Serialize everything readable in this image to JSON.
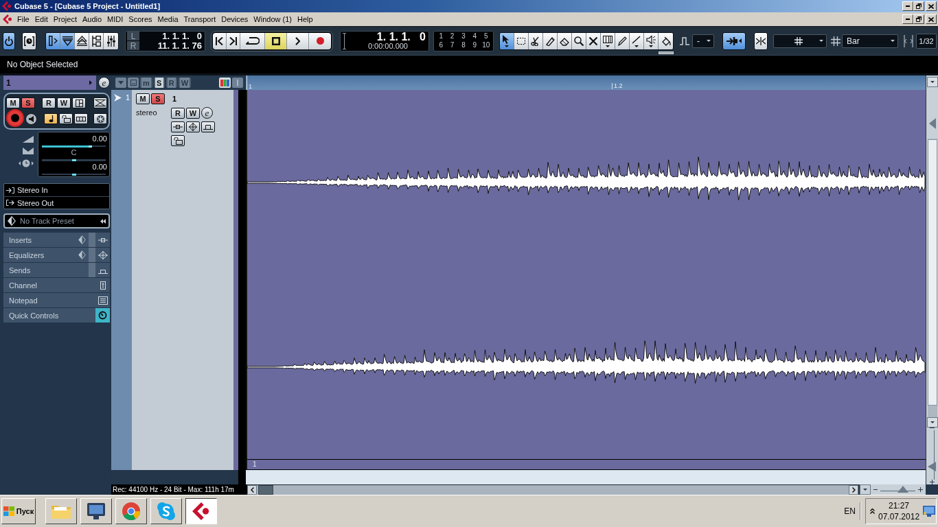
{
  "window": {
    "title": "Cubase 5 - [Cubase 5 Project - Untitled1]"
  },
  "menu": [
    "File",
    "Edit",
    "Project",
    "Audio",
    "MIDI",
    "Scores",
    "Media",
    "Transport",
    "Devices",
    "Window (1)",
    "Help"
  ],
  "toolbar": {
    "activate": {
      "selected": true
    },
    "constrain": {
      "selected": false
    },
    "view_toggles": [
      {
        "selected": true
      },
      {
        "selected": true
      },
      {
        "selected": false
      },
      {
        "selected": false
      },
      {
        "selected": false
      }
    ],
    "locators": [
      {
        "label": "L",
        "value": "1. 1. 1.   0"
      },
      {
        "label": "R",
        "value": "11. 1. 1. 76"
      }
    ],
    "transport": [
      {
        "selected": false
      },
      {
        "selected": false
      },
      {
        "selected": false
      },
      {
        "selected": true
      },
      {
        "selected": false
      },
      {
        "selected": false
      }
    ],
    "time_display": {
      "position": "1. 1. 1.   0",
      "time": "0:00:00.000"
    },
    "markers": [
      "1",
      "2",
      "3",
      "4",
      "5",
      "6",
      "7",
      "8",
      "9",
      "10"
    ],
    "tools": [
      {
        "selected": true
      },
      {
        "selected": false
      },
      {
        "selected": false
      },
      {
        "selected": false
      },
      {
        "selected": false
      },
      {
        "selected": false
      },
      {
        "selected": false
      },
      {
        "selected": false
      },
      {
        "selected": false
      },
      {
        "selected": false
      },
      {
        "selected": false
      },
      {
        "selected": false
      }
    ],
    "dropdown": {
      "value": "-"
    },
    "snap": {
      "selected": true
    },
    "zero_crossing": {
      "selected": false
    },
    "grid": {
      "value": "Bar"
    },
    "quantize": {
      "value": "1/32"
    }
  },
  "info_line": {
    "text": "No Object Selected"
  },
  "inspector": {
    "track_name": "1",
    "edit_button": "e",
    "buttons": [
      {
        "label": "M",
        "selected": false
      },
      {
        "label": "S",
        "selected": true
      },
      {
        "label": "R",
        "selected": false
      },
      {
        "label": "W",
        "selected": false
      }
    ],
    "record_enable": {
      "selected": false
    },
    "monitor": {
      "selected": false
    },
    "timebase": {
      "selected": true
    },
    "volume": {
      "value": "0.00",
      "level": 0.79
    },
    "pan": {
      "value": "C",
      "level": 0.5
    },
    "delay": {
      "value": "0.00",
      "level": 0.5
    },
    "routing": [
      {
        "kind": "input",
        "label": "Stereo In"
      },
      {
        "kind": "output",
        "label": "Stereo Out"
      }
    ],
    "preset": {
      "placeholder": "No Track Preset"
    },
    "sections": [
      {
        "label": "Inserts",
        "active": false
      },
      {
        "label": "Equalizers",
        "active": false
      },
      {
        "label": "Sends",
        "active": false
      },
      {
        "label": "Channel",
        "active": false
      },
      {
        "label": "Notepad",
        "active": false
      },
      {
        "label": "Quick Controls",
        "active": true
      }
    ]
  },
  "track_list": {
    "header_toggles": [
      {
        "label": "m",
        "selected": false
      },
      {
        "label": "S",
        "selected": true
      },
      {
        "label": "R",
        "selected": false
      },
      {
        "label": "W",
        "selected": false
      }
    ],
    "tracks": [
      {
        "number": "1",
        "name": "1",
        "type": "stereo",
        "selected": false,
        "buttons": [
          {
            "label": "M",
            "selected": false
          },
          {
            "label": "S",
            "selected": true
          },
          {
            "label": "R",
            "selected": false
          },
          {
            "label": "W",
            "selected": false
          }
        ],
        "edit_button": "e"
      }
    ]
  },
  "project": {
    "ruler": [
      "1",
      "1.2"
    ],
    "events": [
      {
        "name": "1"
      }
    ],
    "horizontal_zoom": {
      "level": 0.7
    },
    "vertical_zoom": {
      "level": 0.2
    }
  },
  "status_line": "Rec: 44100 Hz - 24 Bit - Max: 111h 17m",
  "taskbar": {
    "start": "Пуск",
    "tasks": [
      {
        "selected": false
      },
      {
        "selected": false
      },
      {
        "selected": false
      },
      {
        "selected": false
      },
      {
        "selected": true
      }
    ],
    "language": "EN",
    "time": "21:27",
    "date": "07.07.2012"
  }
}
